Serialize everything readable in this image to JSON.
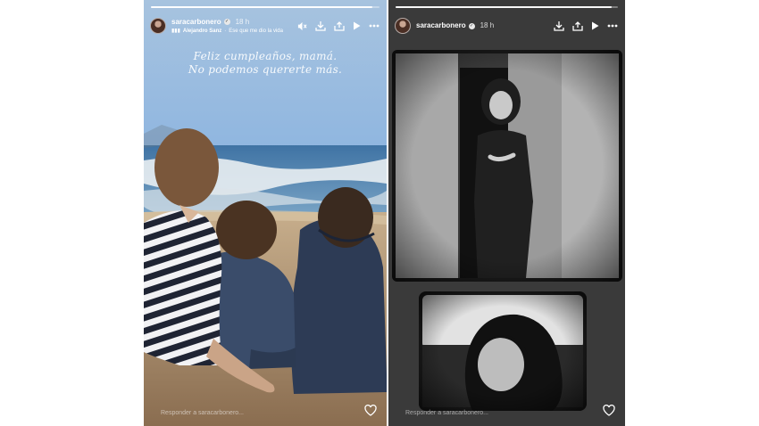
{
  "stories": [
    {
      "progress": 0.97,
      "username": "saracarbonero",
      "time": "18 h",
      "music": {
        "artist": "Alejandro Sanz",
        "separator": "·",
        "song": "Ese que me dio la vida"
      },
      "caption": [
        "Feliz cumpleaños, mamá.",
        "No podemos quererte más."
      ],
      "reply_placeholder": "Responder a saracarbonero...",
      "actions": [
        "mute-icon",
        "download-icon",
        "share-icon",
        "play-icon",
        "more-icon"
      ]
    },
    {
      "progress": 0.97,
      "username": "saracarbonero",
      "time": "18 h",
      "reply_placeholder": "Responder a saracarbonero...",
      "actions": [
        "download-icon",
        "share-icon",
        "play-icon",
        "more-icon"
      ]
    }
  ],
  "colors": {
    "sky": "#9dc0e2",
    "sea": "#5e8fb8",
    "sand": "#b59877",
    "panel": "#3a3a3a"
  }
}
